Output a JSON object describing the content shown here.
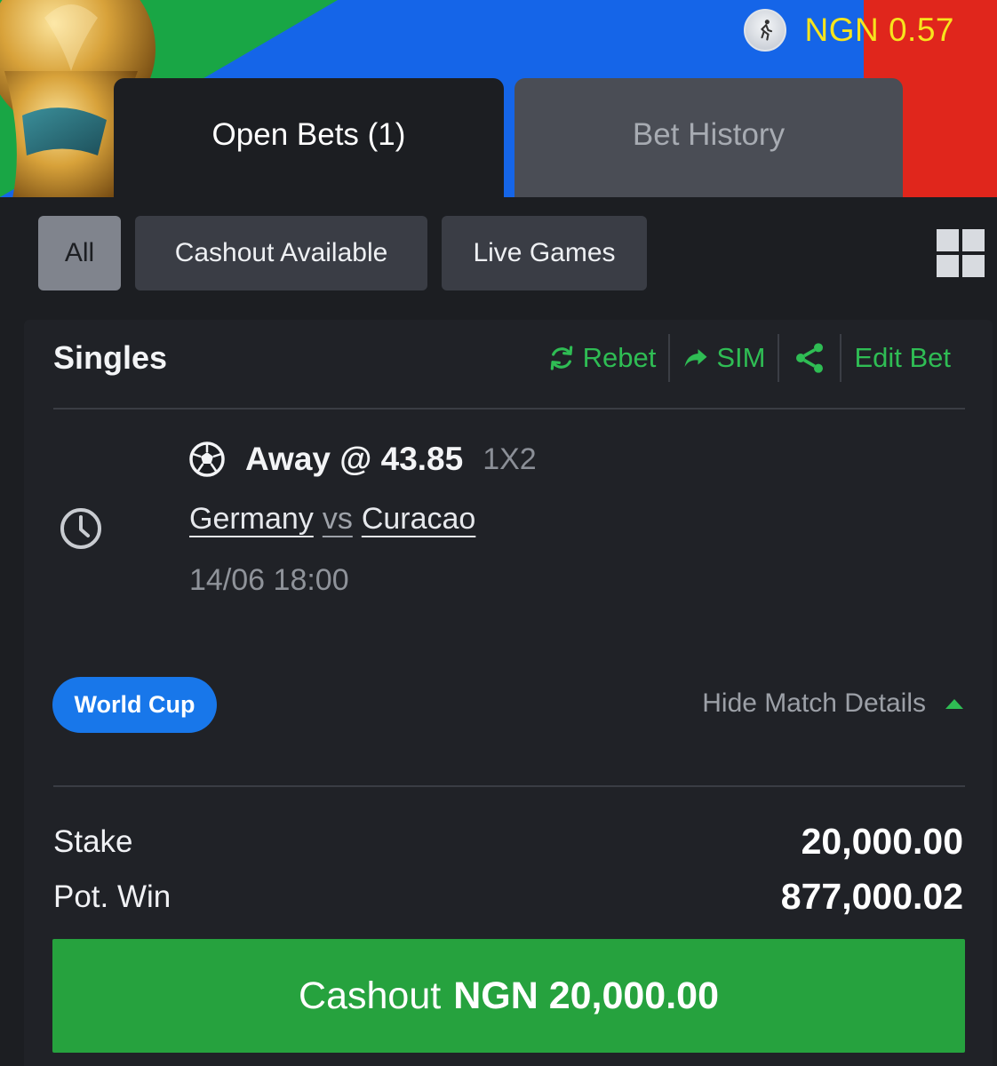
{
  "header": {
    "balance": "NGN 0.57",
    "avatar_icon": "runner-avatar-icon",
    "colors": {
      "green": "#19a645",
      "blue": "#1565e8",
      "red": "#e0261c",
      "balance_text": "#f7e41d"
    }
  },
  "tabs": [
    {
      "label": "Open Bets (1)",
      "active": true
    },
    {
      "label": "Bet History",
      "active": false
    }
  ],
  "filters": [
    {
      "label": "All",
      "selected": true
    },
    {
      "label": "Cashout Available",
      "selected": false
    },
    {
      "label": "Live Games",
      "selected": false
    }
  ],
  "bet": {
    "type_title": "Singles",
    "actions": {
      "rebet": "Rebet",
      "sim": "SIM",
      "share_icon": "share-icon",
      "edit": "Edit Bet"
    },
    "selection": "Away @ 43.85",
    "market": "1X2",
    "home_team": "Germany",
    "vs": "vs",
    "away_team": "Curacao",
    "datetime": "14/06 18:00",
    "competition": "World Cup",
    "toggle_details": "Hide Match Details",
    "stake_label": "Stake",
    "stake_value": "20,000.00",
    "pot_win_label": "Pot. Win",
    "pot_win_value": "877,000.02",
    "cashout_prefix": "Cashout",
    "cashout_amount": "NGN 20,000.00",
    "accent_green": "#2fbd54",
    "cashout_green": "#26a23e",
    "badge_blue": "#1877ea"
  }
}
